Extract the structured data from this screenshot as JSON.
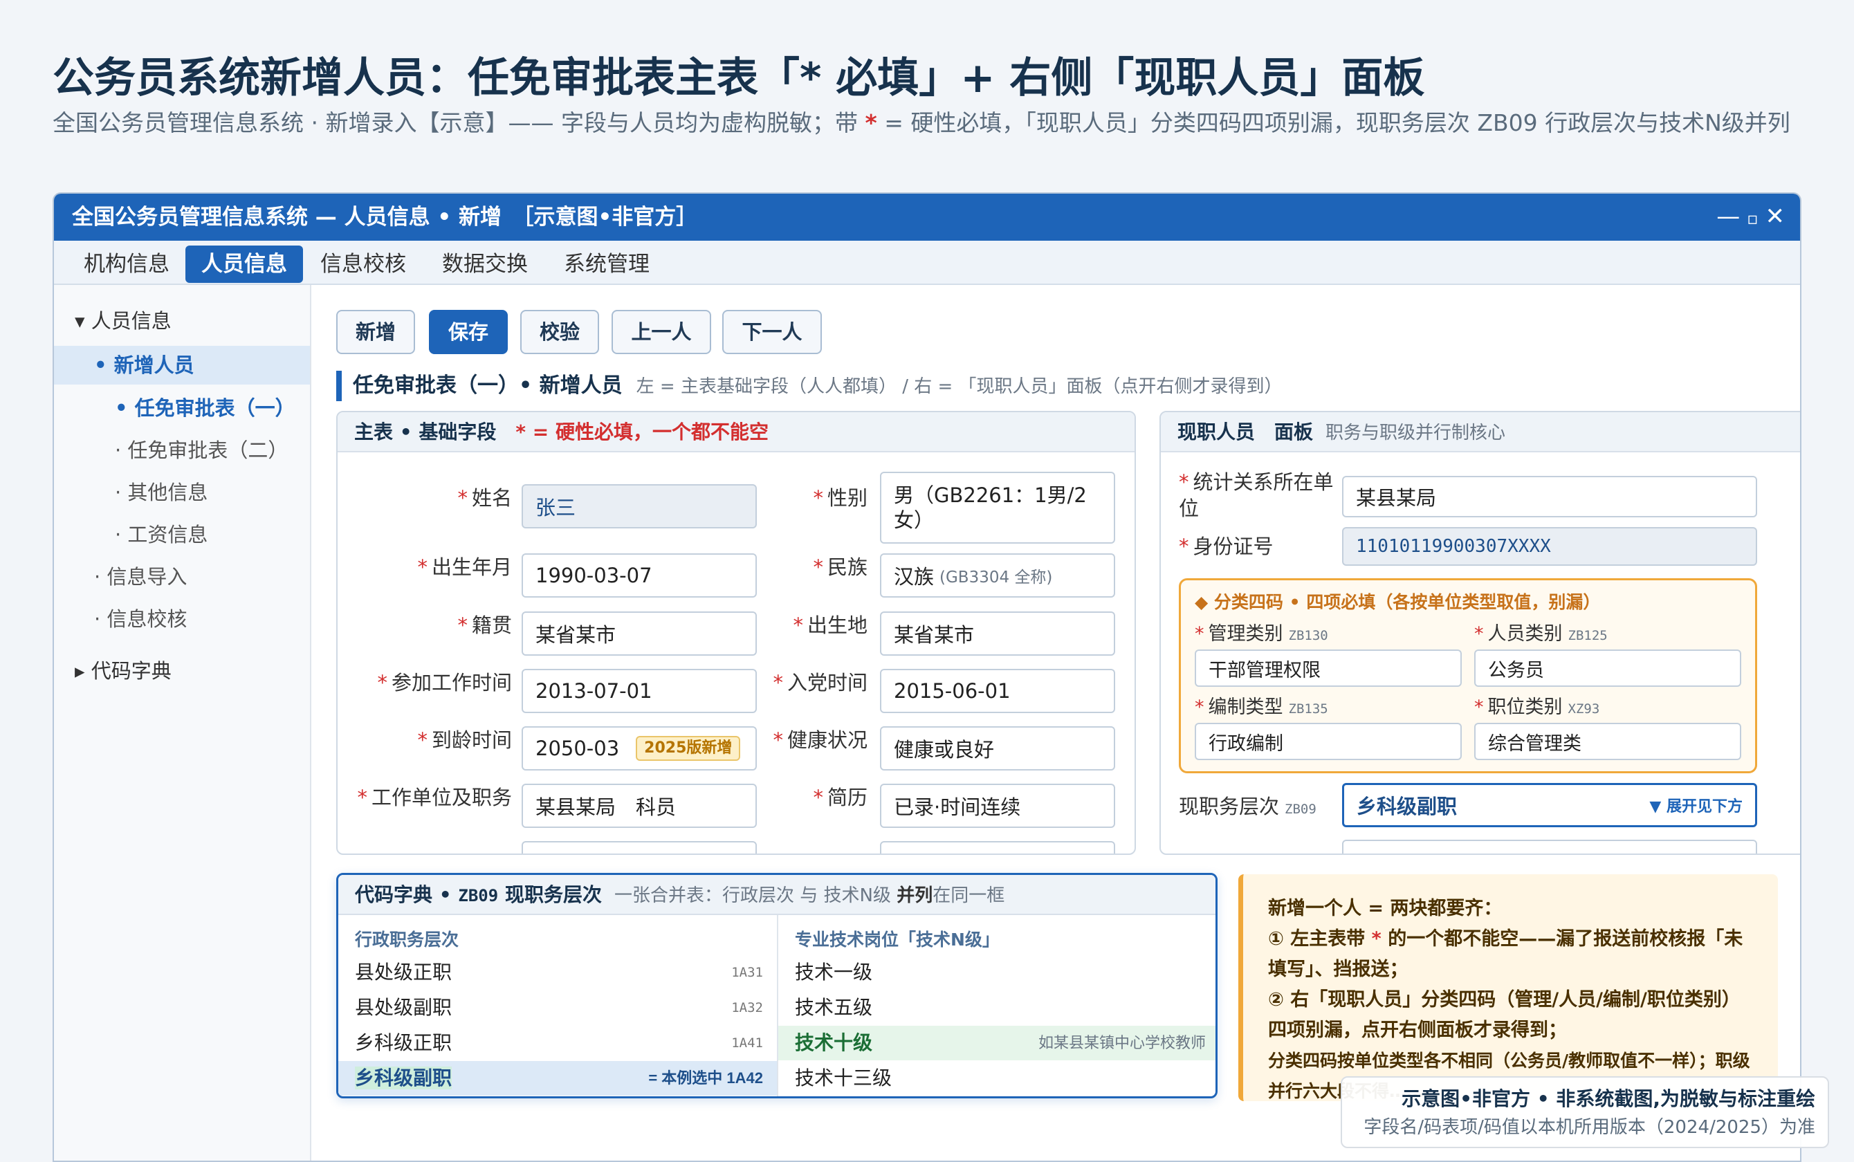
{
  "header": {
    "title": "公务员系统新增人员：任免审批表主表「* 必填」+ 右侧「现职人员」面板",
    "subtitle_pre": "全国公务员管理信息系统 · 新增录入【示意】—— 字段与人员均为虚构脱敏；带 ",
    "subtitle_star": "*",
    "subtitle_post": " = 硬性必填，「现职人员」分类四码四项别漏，现职务层次 ZB09 行政层次与技术N级并列"
  },
  "window": {
    "title": "全国公务员管理信息系统 — 人员信息 • 新增　［示意图•非官方］",
    "controls": [
      "—",
      "▫",
      "✕"
    ]
  },
  "menu": [
    "机构信息",
    "人员信息",
    "信息校核",
    "数据交换",
    "系统管理"
  ],
  "sidebar": {
    "items": [
      {
        "label": "▾ 人员信息"
      },
      {
        "label": "• 新增人员"
      },
      {
        "label": "• 任免审批表（一）"
      },
      {
        "label": "· 任免审批表（二）"
      },
      {
        "label": "· 其他信息"
      },
      {
        "label": "· 工资信息"
      },
      {
        "label": "· 信息导入"
      },
      {
        "label": "· 信息校核"
      },
      {
        "label": "▸ 代码字典"
      }
    ]
  },
  "toolbar": [
    "新增",
    "保存",
    "校验",
    "上一人",
    "下一人"
  ],
  "section": {
    "title": "任免审批表（一）• 新增人员",
    "note": "左 = 主表基础字段（人人都填） / 右 = 「现职人员」面板（点开右侧才录得到）"
  },
  "main_card": {
    "title": "主表 • 基础字段",
    "required_note": "* = 硬性必填，一个都不能空",
    "star": "*",
    "fields": [
      {
        "label": "姓名",
        "value": "张三"
      },
      {
        "label": "性别",
        "value": "男（GB2261：1男/2女）"
      },
      {
        "label": "出生年月",
        "value": "1990-03-07"
      },
      {
        "label": "民族",
        "value": "汉族",
        "extra": "(GB3304 全称)"
      },
      {
        "label": "籍贯",
        "value": "某省某市"
      },
      {
        "label": "出生地",
        "value": "某省某市"
      },
      {
        "label": "参加工作时间",
        "value": "2013-07-01"
      },
      {
        "label": "入党时间",
        "value": "2015-06-01"
      },
      {
        "label": "到龄时间",
        "value": "2050-03",
        "tag": "2025版新增"
      },
      {
        "label": "健康状况",
        "value": "健康或良好"
      },
      {
        "label": "工作单位及职务",
        "value": "某县某局　科员"
      },
      {
        "label": "简历",
        "value": "已录·时间连续"
      }
    ]
  },
  "right_card": {
    "title": "现职人员　面板",
    "note": "职务与职级并行制核心",
    "fields": [
      {
        "label": "统计关系所在单位",
        "value": "某县某局"
      },
      {
        "label": "身份证号",
        "value": "11010119900307XXXX"
      }
    ],
    "four_codes": {
      "title": "◆ 分类四码 • 四项必填（各按单位类型取值，别漏）",
      "items": [
        {
          "label": "管理类别",
          "code": "ZB130",
          "value": "干部管理权限"
        },
        {
          "label": "人员类别",
          "code": "ZB125",
          "value": "公务员"
        },
        {
          "label": "编制类型",
          "code": "ZB135",
          "value": "行政编制"
        },
        {
          "label": "职位类别",
          "code": "XZ93",
          "value": "综合管理类"
        }
      ]
    },
    "level": {
      "label": "现职务层次",
      "code": "ZB09",
      "value": "乡科级副职",
      "hint": "▼ 展开见下方"
    }
  },
  "dict": {
    "title": "代码字典 • ",
    "code": "ZB09",
    "title2": " 现职务层次",
    "note_pre": "一张合并表：行政层次 与 技术N级 ",
    "note_bold": "并列",
    "note_post": "在同一框",
    "left_head": "行政职务层次",
    "right_head": "专业技术岗位「技术N级」",
    "left_rows": [
      {
        "label": "县处级正职",
        "code": "1A31"
      },
      {
        "label": "县处级副职",
        "code": "1A32"
      },
      {
        "label": "乡科级正职",
        "code": "1A41"
      },
      {
        "label": "乡科级副职",
        "code": "= 本例选中 1A42"
      }
    ],
    "right_rows": [
      {
        "label": "技术一级",
        "code": ""
      },
      {
        "label": "技术五级",
        "code": ""
      },
      {
        "label": "技术十级",
        "code": "如某县某镇中心学校教师"
      },
      {
        "label": "技术十三级",
        "code": ""
      }
    ]
  },
  "note_box": {
    "l1": "新增一个人 = 两块都要齐：",
    "l2_pre": "① 左主表带 ",
    "l2_star": "*",
    "l2_post": " 的一个都不能空——漏了报送前校核报「未填写」、挡报送；",
    "l3": "② 右「现职人员」分类四码（管理/人员/编制/职位类别）四项别漏，点开右侧面板才录得到；",
    "l4": "分类四码按单位类型各不相同（公务员/教师取值不一样）；职级并行六大段不得……"
  },
  "watermark": {
    "l1": "示意图•非官方 • 非系统截图,为脱敏与标注重绘",
    "l2": "字段名/码表项/码值以本机所用版本（2024/2025）为准"
  },
  "colors": {
    "accent": "#1e64b8",
    "required": "#d32f2f",
    "warn": "#f0a83a"
  }
}
